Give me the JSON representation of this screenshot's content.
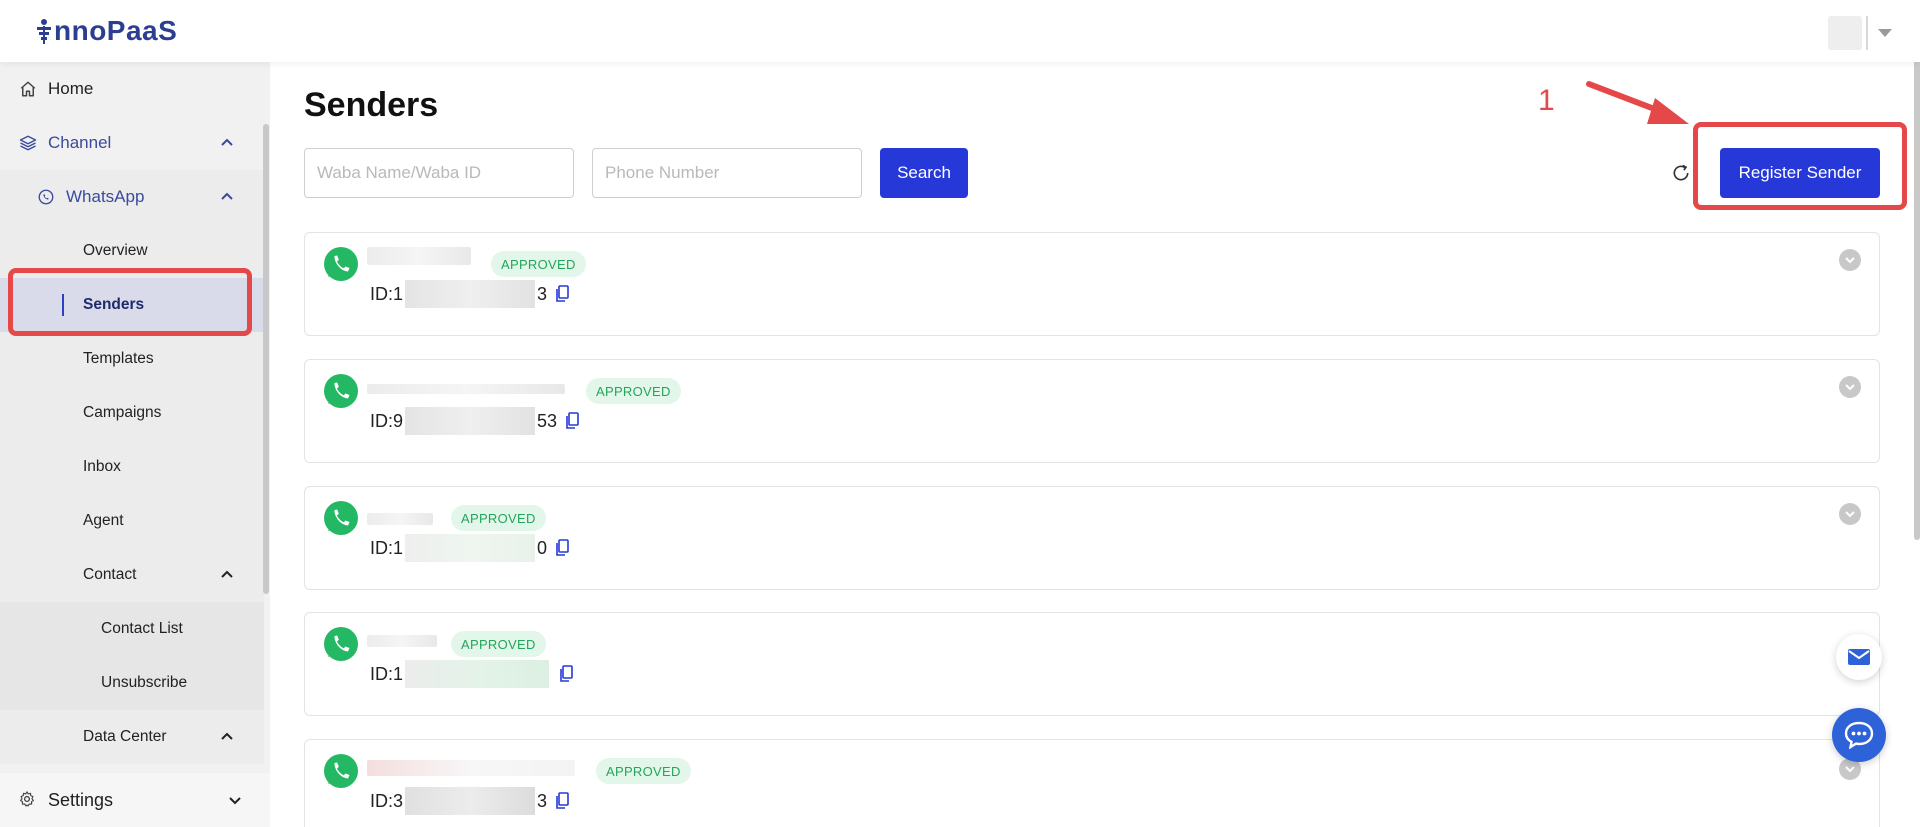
{
  "app": {
    "logo_text": "nnoPaaS",
    "logo_prefix": "I"
  },
  "sidebar": {
    "home": "Home",
    "channel": "Channel",
    "whatsapp": "WhatsApp",
    "items": [
      "Overview",
      "Senders",
      "Templates",
      "Campaigns",
      "Inbox",
      "Agent"
    ],
    "contact": "Contact",
    "contact_items": [
      "Contact List",
      "Unsubscribe"
    ],
    "data_center": "Data Center",
    "settings": "Settings"
  },
  "main": {
    "title": "Senders",
    "search": {
      "waba_placeholder": "Waba Name/Waba ID",
      "phone_placeholder": "Phone Number",
      "button": "Search"
    },
    "register_button": "Register Sender",
    "annotation_number": "1",
    "senders": [
      {
        "status": "APPROVED",
        "id_prefix": "ID:1",
        "id_suffix": "3"
      },
      {
        "status": "APPROVED",
        "id_prefix": "ID:9",
        "id_suffix": "53"
      },
      {
        "status": "APPROVED",
        "id_prefix": "ID:1",
        "id_suffix": "0"
      },
      {
        "status": "APPROVED",
        "id_prefix": "ID:1",
        "id_suffix": ""
      },
      {
        "status": "APPROVED",
        "id_prefix": "ID:3",
        "id_suffix": "3"
      }
    ]
  },
  "colors": {
    "primary": "#2738d9",
    "whatsapp_green": "#25b864",
    "badge_bg": "#e3f6ea",
    "badge_text": "#23a55a",
    "annotation_red": "#e54848",
    "nav_blue": "#3a4a9c"
  },
  "icons": {
    "home": "home-icon",
    "channel": "layers-icon",
    "whatsapp": "whatsapp-icon",
    "settings": "gear-icon",
    "copy": "copy-icon",
    "refresh": "refresh-icon",
    "expand": "chevron-down-icon",
    "mail": "mail-icon",
    "chat": "chat-icon"
  }
}
